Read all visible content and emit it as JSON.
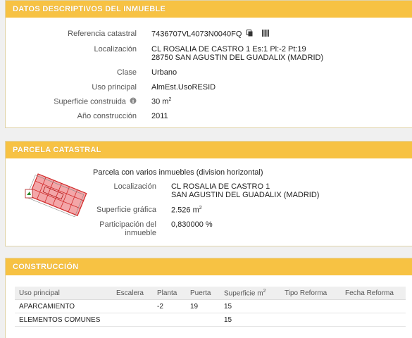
{
  "datos": {
    "title": "DATOS DESCRIPTIVOS DEL INMUEBLE",
    "ref_label": "Referencia catastral",
    "ref_value": "7436707VL4073N0040FQ",
    "loc_label": "Localización",
    "loc_line1": "CL ROSALIA DE CASTRO 1 Es:1 Pl:-2 Pt:19",
    "loc_line2": "28750 SAN AGUSTIN DEL GUADALIX (MADRID)",
    "clase_label": "Clase",
    "clase_value": "Urbano",
    "uso_label": "Uso principal",
    "uso_value": "AlmEst.UsoRESID",
    "sup_label": "Superficie construida",
    "sup_value": "30 m",
    "sup_sup": "2",
    "anio_label": "Año construcción",
    "anio_value": "2011"
  },
  "parcela": {
    "title": "PARCELA CATASTRAL",
    "desc": "Parcela con varios inmuebles (division horizontal)",
    "loc_label": "Localización",
    "loc_line1": "CL ROSALIA DE CASTRO 1",
    "loc_line2": "SAN AGUSTIN DEL GUADALIX (MADRID)",
    "sup_label": "Superficie gráfica",
    "sup_value": "2.526 m",
    "sup_sup": "2",
    "part_label_1": "Participación del",
    "part_label_2": "inmueble",
    "part_value": "0,830000 %"
  },
  "construccion": {
    "title": "CONSTRUCCIÓN",
    "headers": {
      "uso": "Uso principal",
      "escalera": "Escalera",
      "planta": "Planta",
      "puerta": "Puerta",
      "superficie": "Superficie m",
      "superficie_sup": "2",
      "tipo": "Tipo Reforma",
      "fecha": "Fecha Reforma"
    },
    "rows": [
      {
        "uso": "APARCAMIENTO",
        "escalera": "",
        "planta": "-2",
        "puerta": "19",
        "superficie": "15",
        "tipo": "",
        "fecha": ""
      },
      {
        "uso": "ELEMENTOS COMUNES",
        "escalera": "",
        "planta": "",
        "puerta": "",
        "superficie": "15",
        "tipo": "",
        "fecha": ""
      }
    ]
  },
  "colors": {
    "header_bg": "#f7c243",
    "map_fill": "#f3a6a8",
    "map_line": "#d02a2a"
  },
  "icons": [
    "copy-icon",
    "barcode-icon",
    "info-icon"
  ]
}
